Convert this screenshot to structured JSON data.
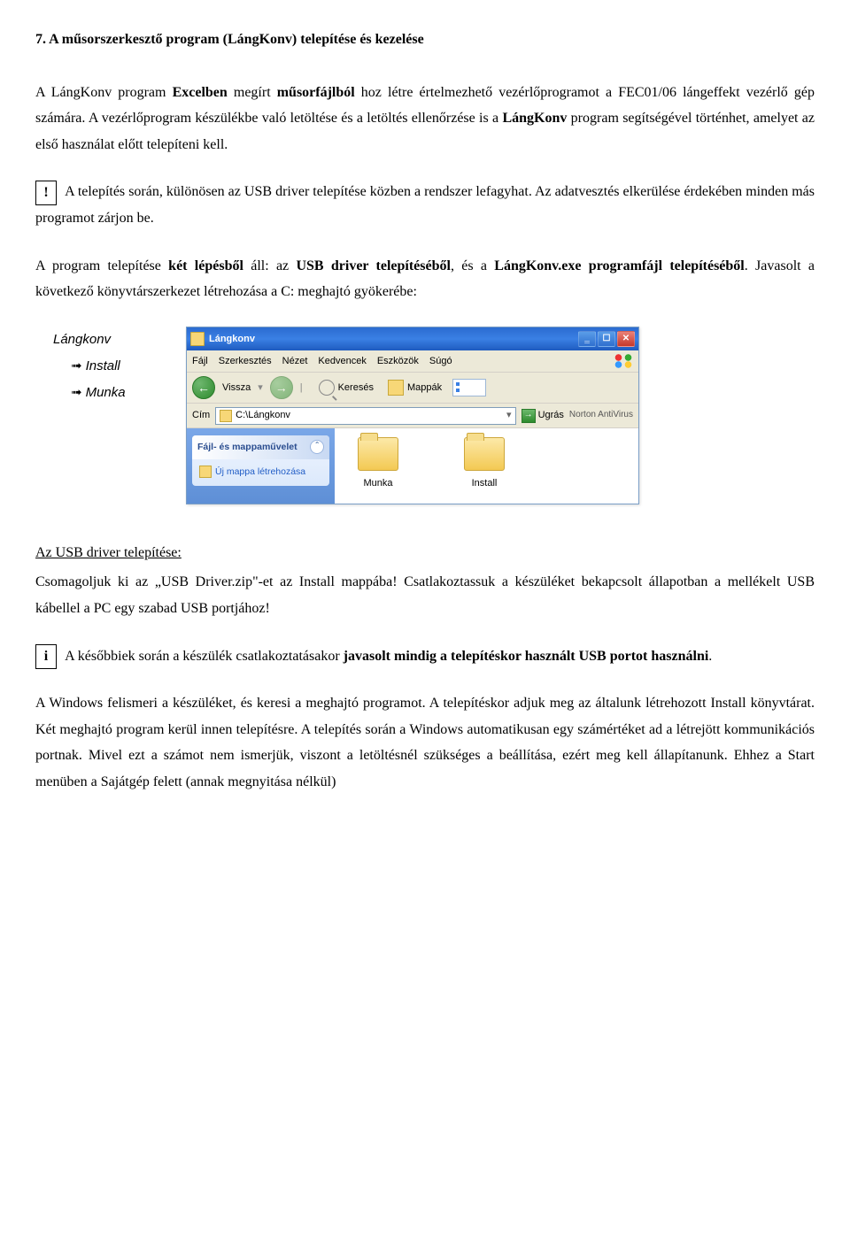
{
  "heading": "7. A műsorszerkesztő program (LángKonv) telepítése és kezelése",
  "para1a": "A LángKonv program ",
  "para1b": "Excelben",
  "para1c": " megírt ",
  "para1d": "műsorfájlból",
  "para1e": " hoz létre értelmezhető vezérlőprogramot a FEC01/06 lángeffekt vezérlő gép számára. A vezérlőprogram készülékbe való letöltése és a letöltés ellenőrzése is a ",
  "para1f": "LángKonv",
  "para1g": " program segítségével történhet, amelyet az első használat előtt telepíteni kell.",
  "warn_symbol": "!",
  "para2": " A telepítés során, különösen az USB driver telepítése közben a rendszer lefagyhat. Az adatvesztés elkerülése érdekében minden más programot zárjon be.",
  "para3a": "A program telepítése ",
  "para3b": "két lépésből",
  "para3c": " áll: az ",
  "para3d": "USB driver telepítéséből",
  "para3e": ", és a ",
  "para3f": "LángKonv.exe programfájl telepítéséből",
  "para3g": ". Javasolt a következő könyvtárszerkezet létrehozása a C: meghajtó gyökerébe:",
  "tree": {
    "root": "Lángkonv",
    "child1": "Install",
    "child2": "Munka"
  },
  "explorer": {
    "title": "Lángkonv",
    "menu": {
      "fajl": "Fájl",
      "szerk": "Szerkesztés",
      "nezet": "Nézet",
      "kedv": "Kedvencek",
      "eszk": "Eszközök",
      "sugo": "Súgó"
    },
    "toolbar": {
      "vissza": "Vissza",
      "kereses": "Keresés",
      "mappak": "Mappák"
    },
    "addr": {
      "label": "Cím",
      "path": "C:\\Lángkonv",
      "ugras": "Ugrás",
      "norton": "Norton AntiVirus"
    },
    "task": {
      "header": "Fájl- és mappaművelet",
      "newfolder": "Új mappa létrehozása"
    },
    "folders": {
      "munka": "Munka",
      "install": "Install"
    }
  },
  "usb_heading": "Az USB driver telepítése:",
  "para4": "Csomagoljuk ki az „USB Driver.zip\"-et az Install mappába! Csatlakoztassuk a készüléket bekapcsolt állapotban a mellékelt USB kábellel a PC egy szabad USB portjához!",
  "info_symbol": "i",
  "para5a": " A későbbiek során a készülék csatlakoztatásakor ",
  "para5b": "javasolt mindig a telepítéskor használt USB portot használni",
  "para5c": ".",
  "para6": "A Windows felismeri a készüléket, és keresi a meghajtó programot. A telepítéskor adjuk meg az általunk létrehozott Install könyvtárat. Két meghajtó program kerül innen telepítésre. A telepítés során a Windows automatikusan egy számértéket ad a létrejött kommunikációs portnak. Mivel ezt a számot nem ismerjük, viszont a letöltésnél szükséges a beállítása, ezért meg kell állapítanunk. Ehhez a Start menüben a Sajátgép felett (annak megnyitása nélkül)"
}
